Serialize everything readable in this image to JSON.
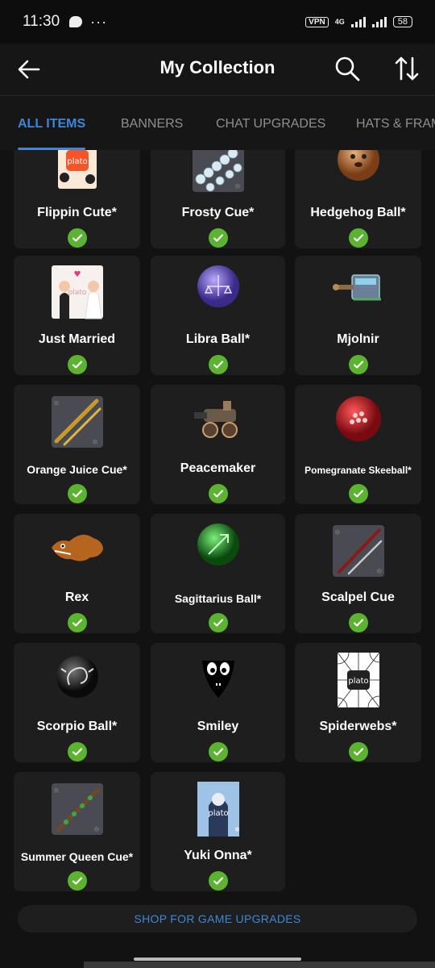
{
  "status_bar": {
    "time": "11:30",
    "dots": "···",
    "vpn": "VPN",
    "network": "4G",
    "battery": "58"
  },
  "header": {
    "title": "My Collection"
  },
  "tabs": [
    {
      "label": "ALL ITEMS",
      "active": true
    },
    {
      "label": "BANNERS",
      "active": false
    },
    {
      "label": "CHAT UPGRADES",
      "active": false
    },
    {
      "label": "HATS & FRAMES",
      "active": false
    }
  ],
  "items": [
    {
      "name": "Flippin Cute*",
      "icon": "flippin-cute-thumbnail",
      "owned": true
    },
    {
      "name": "Frosty Cue*",
      "icon": "frosty-cue-thumbnail",
      "owned": true
    },
    {
      "name": "Hedgehog Ball*",
      "icon": "hedgehog-ball-thumbnail",
      "owned": true
    },
    {
      "name": "Just Married",
      "icon": "just-married-thumbnail",
      "owned": true
    },
    {
      "name": "Libra Ball*",
      "icon": "libra-ball-thumbnail",
      "owned": true
    },
    {
      "name": "Mjolnir",
      "icon": "mjolnir-thumbnail",
      "owned": true
    },
    {
      "name": "Orange Juice Cue*",
      "icon": "orange-juice-cue-thumbnail",
      "owned": true
    },
    {
      "name": "Peacemaker",
      "icon": "peacemaker-thumbnail",
      "owned": true
    },
    {
      "name": "Pomegranate Skeeball*",
      "icon": "pomegranate-skeeball-thumbnail",
      "owned": true
    },
    {
      "name": "Rex",
      "icon": "rex-thumbnail",
      "owned": true
    },
    {
      "name": "Sagittarius Ball*",
      "icon": "sagittarius-ball-thumbnail",
      "owned": true
    },
    {
      "name": "Scalpel Cue",
      "icon": "scalpel-cue-thumbnail",
      "owned": true
    },
    {
      "name": "Scorpio Ball*",
      "icon": "scorpio-ball-thumbnail",
      "owned": true
    },
    {
      "name": "Smiley",
      "icon": "smiley-thumbnail",
      "owned": true
    },
    {
      "name": "Spiderwebs*",
      "icon": "spiderwebs-thumbnail",
      "owned": true
    },
    {
      "name": "Summer Queen Cue*",
      "icon": "summer-queen-cue-thumbnail",
      "owned": true
    },
    {
      "name": "Yuki Onna*",
      "icon": "yuki-onna-thumbnail",
      "owned": true
    }
  ],
  "thumb_brand": "plato",
  "shop_button": {
    "label": "SHOP FOR GAME UPGRADES"
  },
  "colors": {
    "accent": "#3f86d8",
    "owned_check": "#5cb331",
    "card_bg": "#1e1e1e",
    "page_bg": "#121212"
  }
}
